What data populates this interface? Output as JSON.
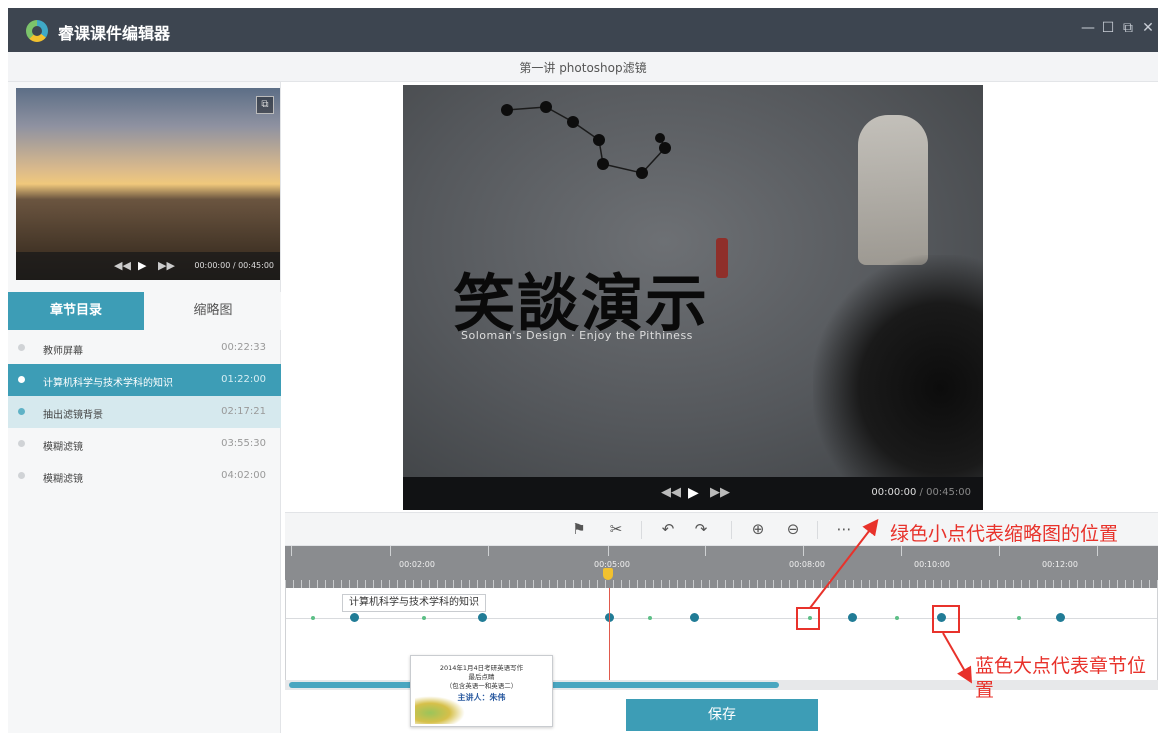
{
  "window": {
    "app_title": "睿课课件编辑器",
    "controls": [
      "—",
      "☐",
      "⧉",
      "✕"
    ]
  },
  "document": {
    "title": "第一讲 photoshop滤镜"
  },
  "sidebar": {
    "preview": {
      "time": "00:00:00 / 00:45:00"
    },
    "tabs": [
      {
        "label": "章节目录",
        "active": true
      },
      {
        "label": "缩略图",
        "active": false
      }
    ],
    "chapters": [
      {
        "name": "教师屏幕",
        "duration": "00:22:33",
        "state": "normal"
      },
      {
        "name": "计算机科学与技术学科的知识",
        "duration": "01:22:00",
        "state": "selected"
      },
      {
        "name": "抽出滤镜背景",
        "duration": "02:17:21",
        "state": "hover"
      },
      {
        "name": "模糊滤镜",
        "duration": "03:55:30",
        "state": "normal"
      },
      {
        "name": "模糊滤镜",
        "duration": "04:02:00",
        "state": "normal"
      }
    ]
  },
  "player": {
    "slide": {
      "calligraphy": "笑談演示",
      "slogan": "Soloman's Design · Enjoy the Pithiness"
    },
    "current_time": "00:00:00",
    "total_time": "/ 00:45:00"
  },
  "toolbar": {
    "icons": [
      "flag-icon",
      "scissors-icon",
      "undo-icon",
      "redo-icon",
      "zoom-in-icon",
      "zoom-out-icon",
      "more-icon"
    ]
  },
  "timeline": {
    "ruler_labels": [
      "00:02:00",
      "00:05:00",
      "00:08:00",
      "00:10:00",
      "00:12:00"
    ],
    "chapter_tooltip": "计算机科学与技术学科的知识",
    "thumbnail_card": {
      "line1": "2014年1月4日考研英语写作",
      "line2": "最后点睛",
      "line3": "（包含英语一和英语二）",
      "lecturer": "主讲人：朱伟"
    }
  },
  "actions": {
    "save_label": "保存"
  },
  "annotations": {
    "green_dot_note": "绿色小点代表缩略图的位置",
    "blue_dot_note": "蓝色大点代表章节位置"
  },
  "colors": {
    "accent": "#3d9db6",
    "titlebar": "#3d4550",
    "chapter_dot": "#217c96",
    "thumbnail_dot": "#5cbf86",
    "annotation": "#e8322b",
    "playhead": "#f2c12e"
  }
}
